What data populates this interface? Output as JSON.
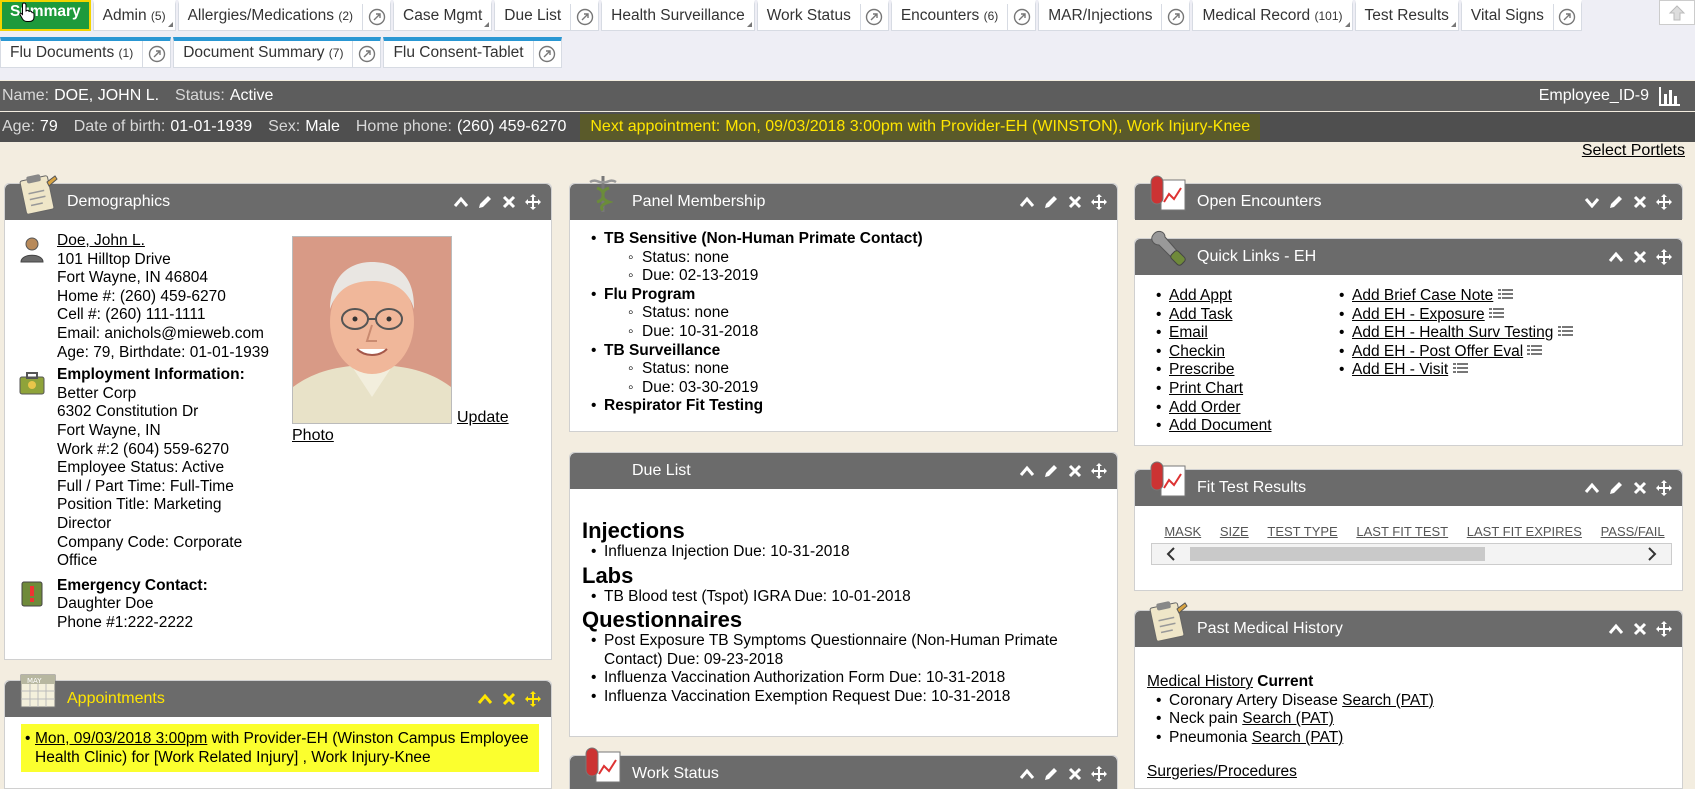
{
  "tabs_row1": [
    {
      "label": "Summary",
      "active": true
    },
    {
      "label": "Admin",
      "count": "(5)",
      "corner": true
    },
    {
      "label": "Allergies/Medications",
      "count": "(2)",
      "popout": true
    },
    {
      "label": "Case Mgmt",
      "corner": true
    },
    {
      "label": "Due List",
      "popout": true
    },
    {
      "label": "Health Surveillance",
      "corner": true
    },
    {
      "label": "Work Status",
      "popout": true
    },
    {
      "label": "Encounters",
      "count": "(6)",
      "popout": true
    },
    {
      "label": "MAR/Injections",
      "popout": true
    },
    {
      "label": "Medical Record",
      "count": "(101)",
      "corner": true
    },
    {
      "label": "Test Results",
      "corner": true
    },
    {
      "label": "Vital Signs",
      "popout": true
    }
  ],
  "tabs_row2": [
    {
      "label": "Flu Documents",
      "count": "(1)",
      "popout": true
    },
    {
      "label": "Document Summary",
      "count": "(7)",
      "popout": true
    },
    {
      "label": "Flu Consent-Tablet",
      "popout": true
    }
  ],
  "patient": {
    "name_label": "Name:",
    "name": "DOE, JOHN L.",
    "status_label": "Status:",
    "status": "Active",
    "employee_id": "Employee_ID-9",
    "age_label": "Age:",
    "age": "79",
    "dob_label": "Date of birth:",
    "dob": "01-01-1939",
    "sex_label": "Sex:",
    "sex": "Male",
    "phone_label": "Home phone:",
    "phone": "(260) 459-6270",
    "next_appt_label": "Next appointment:",
    "next_appt": "Mon, 09/03/2018 3:00pm with Provider-EH (WINSTON), Work Injury-Knee"
  },
  "select_portlets": "Select Portlets",
  "demographics": {
    "title": "Demographics",
    "name_link": "Doe, John L.",
    "address_lines": [
      "101 Hilltop Drive",
      "Fort Wayne, IN 46804",
      "Home #: (260) 459-6270",
      "Cell #: (260) 111-1111",
      "Email: anichols@mieweb.com",
      "Age: 79, Birthdate: 01-01-1939"
    ],
    "employment_heading": "Employment Information:",
    "employment_lines": [
      "Better Corp",
      "6302 Constitution Dr",
      "Fort Wayne, IN",
      "Work #:2 (604) 559-6270",
      "Employee Status: Active",
      "Full / Part Time: Full-Time",
      "Position Title: Marketing Director",
      "Company Code: Corporate Office"
    ],
    "emergency_heading": "Emergency Contact:",
    "emergency_lines": [
      "Daughter Doe",
      "Phone #1:222-2222"
    ],
    "update_photo_1": "Update",
    "update_photo_2": "Photo"
  },
  "appointments": {
    "title": "Appointments",
    "link": "Mon, 09/03/2018 3:00pm",
    "rest": " with Provider-EH (Winston Campus Employee Health Clinic) for [Work Related Injury] , Work Injury-Knee"
  },
  "panel_membership": {
    "title": "Panel Membership",
    "items": [
      {
        "name": "TB Sensitive (Non-Human Primate Contact)",
        "status": "Status: none",
        "due": "Due: 02-13-2019"
      },
      {
        "name": "Flu Program",
        "status": "Status: none",
        "due": "Due: 10-31-2018"
      },
      {
        "name": "TB Surveillance",
        "status": "Status: none",
        "due": "Due: 03-30-2019"
      },
      {
        "name": "Respirator Fit Testing"
      }
    ]
  },
  "due_list": {
    "title": "Due List",
    "sections": [
      {
        "heading": "Injections",
        "items": [
          "Influenza Injection Due: 10-31-2018"
        ]
      },
      {
        "heading": "Labs",
        "items": [
          "TB Blood test (Tspot) IGRA Due: 10-01-2018"
        ]
      },
      {
        "heading": "Questionnaires",
        "items": [
          "Post Exposure TB Symptoms Questionnaire (Non-Human Primate Contact) Due: 09-23-2018",
          "Influenza Vaccination Authorization Form Due: 10-31-2018",
          "Influenza Vaccination Exemption Request Due: 10-31-2018"
        ]
      }
    ]
  },
  "work_status": {
    "title": "Work Status"
  },
  "open_encounters": {
    "title": "Open Encounters"
  },
  "quick_links": {
    "title": "Quick Links - EH",
    "col1": [
      "Add Appt",
      "Add Task",
      "Email",
      "Checkin",
      "Prescribe",
      "Print Chart",
      "Add Order",
      "Add Document"
    ],
    "col2": [
      "Add Brief Case Note",
      "Add EH - Exposure",
      "Add EH - Health Surv Testing",
      "Add EH - Post Offer Eval",
      "Add EH - Visit"
    ]
  },
  "fit_test": {
    "title": "Fit Test Results",
    "columns": [
      "MASK",
      "SIZE",
      "TEST TYPE",
      "LAST FIT TEST",
      "LAST FIT EXPIRES",
      "PASS/FAIL"
    ]
  },
  "past_medical": {
    "title": "Past Medical History",
    "mh_link": "Medical History",
    "current": "Current",
    "items": [
      {
        "name": "Coronary Artery Disease",
        "link": "Search (PAT)"
      },
      {
        "name": "Neck pain",
        "link": "Search (PAT)"
      },
      {
        "name": "Pneumonia",
        "link": "Search (PAT)"
      }
    ],
    "surgeries_link": "Surgeries/Procedures"
  },
  "colors": {
    "active_tab": "#1e9a3c",
    "highlight": "#fbff2e",
    "header_bg": "#6b6b6b",
    "doc_tab_accent": "#2a97d3",
    "appt_text": "#ffe600"
  }
}
